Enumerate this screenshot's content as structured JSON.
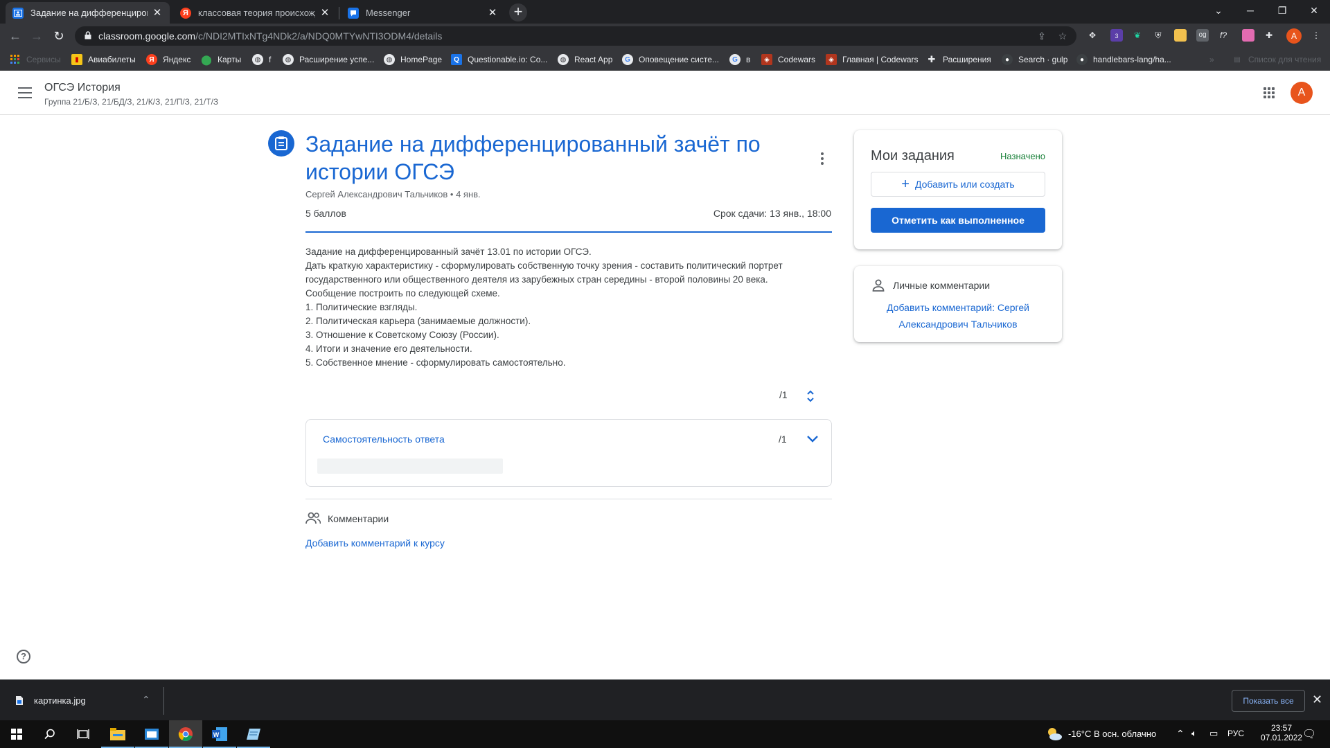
{
  "browser": {
    "tabs": [
      {
        "title": "Задание на дифференцирован",
        "favicon": "classroom-icon",
        "active": true
      },
      {
        "title": "классовая теория происхожден",
        "favicon": "yandex-icon",
        "active": false
      },
      {
        "title": "Messenger",
        "favicon": "messenger-icon",
        "active": false
      }
    ],
    "close_glyph": "✕",
    "url_host": "classroom.google.com",
    "url_path": "/c/NDI2MTIxNTg4NDk2/a/NDQ0MTYwNTI3ODM4/details",
    "profile_initial": "A",
    "extension_badge": "3"
  },
  "bookmarks": [
    {
      "label": "Сервисы",
      "icon": "apps-icon",
      "faded": true
    },
    {
      "label": "Авиабилеты",
      "icon": "tickets-icon",
      "color": "#f5c518"
    },
    {
      "label": "Яндекс",
      "icon": "yandex-icon",
      "color": "#fc3f1d"
    },
    {
      "label": "Карты",
      "icon": "maps-pin-icon",
      "color": "#34a853"
    },
    {
      "label": "f",
      "icon": "globe-icon",
      "color": "#e8eaed"
    },
    {
      "label": "Расширение успе...",
      "icon": "globe-icon",
      "color": "#e8eaed"
    },
    {
      "label": "HomePage",
      "icon": "globe-icon",
      "color": "#e8eaed"
    },
    {
      "label": "Questionable.io: Co...",
      "icon": "questionable-icon",
      "color": "#1a73e8"
    },
    {
      "label": "React App",
      "icon": "globe-icon",
      "color": "#e8eaed"
    },
    {
      "label": "Оповещение систе...",
      "icon": "google-icon",
      "color": "#e8eaed"
    },
    {
      "label": "в",
      "icon": "google-icon",
      "color": "#e8eaed"
    },
    {
      "label": "Codewars",
      "icon": "codewars-icon",
      "color": "#b1361e"
    },
    {
      "label": "Главная | Codewars",
      "icon": "codewars-icon",
      "color": "#b1361e"
    },
    {
      "label": "Расширения",
      "icon": "puzzle-icon",
      "color": "#e8eaed"
    },
    {
      "label": "Search · gulp",
      "icon": "github-icon",
      "color": "#3c4043"
    },
    {
      "label": "handlebars-lang/ha...",
      "icon": "github-icon",
      "color": "#3c4043"
    },
    {
      "label": "Список для чтения",
      "icon": "reading-list-icon",
      "faded": true
    }
  ],
  "header": {
    "class_name": "ОГСЭ История",
    "class_groups": "Группа 21/Б/З, 21/БД/З, 21/К/З, 21/П/З, 21/Т/З",
    "avatar_initial": "A"
  },
  "assignment": {
    "title": "Задание на дифференцированный зачёт по истории ОГСЭ",
    "author_date": "Сергей Александрович Тальчиков • 4 янв.",
    "points": "5 баллов",
    "due": "Срок сдачи: 13 янв., 18:00",
    "description": [
      "Задание на дифференцированный зачёт 13.01 по истории ОГСЭ.",
      "Дать краткую характеристику - сформулировать собственную точку зрения - составить политический портрет",
      "государственного или общественного деятеля из зарубежных стран середины - второй половины 20 века.",
      "Сообщение построить по следующей схеме.",
      "1. Политические взгляды.",
      "2. Политическая карьера (занимаемые должности).",
      "3. Отношение к Советскому Союзу (России).",
      "4. Итоги и значение его деятельности.",
      "5. Собственное мнение - сформулировать самостоятельно."
    ],
    "total_score": "/1",
    "rubric": {
      "criterion": "Самостоятельность ответа",
      "score": "/1"
    },
    "comments_label": "Комментарии",
    "add_class_comment": "Добавить комментарий к курсу"
  },
  "my_work": {
    "title": "Мои задания",
    "status": "Назначено",
    "status_color": "#188038",
    "add_label": "Добавить или создать",
    "mark_done_label": "Отметить как выполненное"
  },
  "private_comments": {
    "title": "Личные комментарии",
    "add_label": "Добавить комментарий: Сергей Александрович Тальчиков"
  },
  "download_shelf": {
    "file_name": "картинка.jpg",
    "show_all_label": "Показать все"
  },
  "taskbar": {
    "weather": "-16°C  В осн. облачно",
    "language": "РУС",
    "time": "23:57",
    "date": "07.01.2022"
  },
  "colors": {
    "accent": "#1967d2",
    "chrome_dark": "#202124",
    "avatar": "#e8541c"
  }
}
